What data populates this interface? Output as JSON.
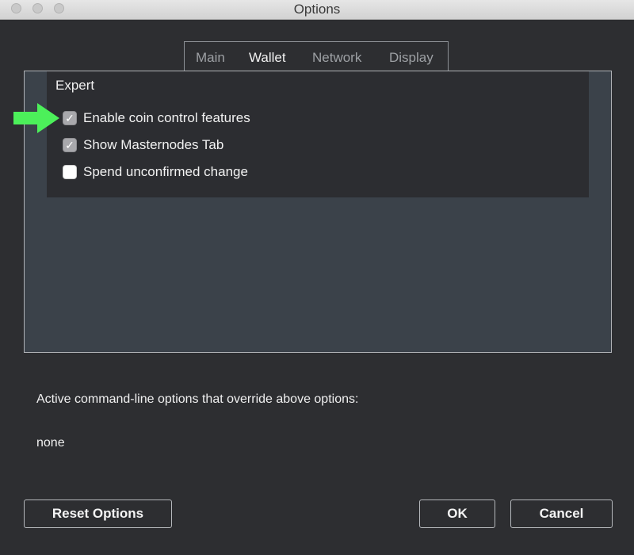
{
  "window": {
    "title": "Options"
  },
  "tabs": [
    {
      "label": "Main",
      "active": false
    },
    {
      "label": "Wallet",
      "active": true
    },
    {
      "label": "Network",
      "active": false
    },
    {
      "label": "Display",
      "active": false
    }
  ],
  "expert": {
    "title": "Expert",
    "options": [
      {
        "label": "Enable coin control features",
        "checked": true
      },
      {
        "label": "Show Masternodes Tab",
        "checked": true
      },
      {
        "label": "Spend unconfirmed change",
        "checked": false
      }
    ]
  },
  "overrides": {
    "label": "Active command-line options that override above options:",
    "value": "none"
  },
  "buttons": {
    "reset": "Reset Options",
    "ok": "OK",
    "cancel": "Cancel"
  },
  "colors": {
    "arrow": "#4cf05a",
    "panel": "#3b424a",
    "background": "#2d2e31"
  },
  "icons": {
    "checkmark": "✓"
  }
}
